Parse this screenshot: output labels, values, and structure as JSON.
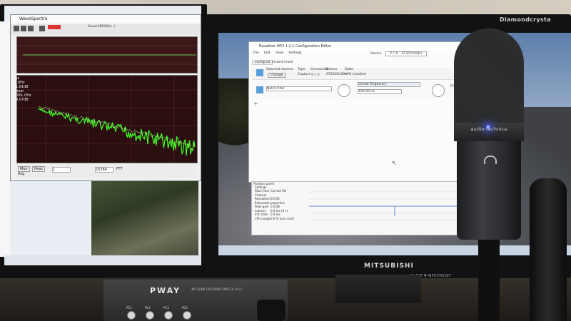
{
  "left_monitor": {
    "wavespectra": {
      "title": "WaveSpectra",
      "toolbar_device": "Sound AB1000s(...)",
      "readout_lines": [
        "Max",
        "21.0Hz",
        "-81.81dB",
        "Cursor",
        "1000L.0Hz",
        "-99.07dB"
      ],
      "top_plot_ticks": [
        "-100000",
        "-0",
        "-100000"
      ],
      "main_plot_ticks": [
        "-60",
        "-80",
        "-100",
        "-120"
      ],
      "x_ticks": [
        "20",
        "100",
        "1k",
        "10k"
      ],
      "bottom_buttons": [
        "Mon",
        "Peak",
        "Avg"
      ],
      "bottom_fields": [
        "1",
        "16384",
        "FFT"
      ]
    }
  },
  "right_monitor": {
    "brand": "Diamondcrysta",
    "bottom_brand": "MITSUBISHI",
    "bottom_hint": "▲ SELECT ▼ INPUT/RESET",
    "equalizer_apo": {
      "title": "Equalizer APO 1.2.1 Configuration Editor",
      "menu": [
        "File",
        "Edit",
        "View",
        "Settings"
      ],
      "device_label": "Device",
      "device_value": "マイク - AT2020USB+",
      "tab": "config.txt",
      "header": {
        "selected_devices": "Selected devices",
        "change_button": "Change",
        "type_label": "Type",
        "type_value": "Capture",
        "connection_label": "Connection",
        "connection_value": "マイク",
        "device_label": "Device",
        "device_value": "AT2020USB+",
        "state_label": "State",
        "state_value": "APO installed",
        "instant_mode": "Instant mode"
      },
      "filter": {
        "type": "Notch filter",
        "param_label": "Center frequency",
        "param_value": "120.00 Hz",
        "gain_label": "Fil"
      }
    },
    "analysis_panel": {
      "title": "Analysis panel",
      "settings": "Settings",
      "lines": [
        "Start from",
        "Channel",
        "Resolution",
        "Estimated properties",
        "Peak gain",
        "Latency",
        "Init. time",
        "CPU usage"
      ],
      "values": [
        "Current file",
        "",
        "65536",
        "",
        "0.0 dB",
        "0.0 ms (0 s)",
        "0.0 ms",
        "0.0 % (one core)"
      ],
      "y_ticks": [
        "40",
        "20",
        "0",
        "-20",
        "-40",
        "-60",
        "-80"
      ]
    }
  },
  "microphone": {
    "brand": "audio-technica"
  },
  "kvm_switch": {
    "brand": "PWAY",
    "model": "4K HDMI USB KVM SWITCH 4×1",
    "button_labels": [
      "PC1",
      "PC2",
      "PC3",
      "PC4"
    ]
  },
  "colors": {
    "spectrum_trace": "#44ff2a",
    "plot_background": "#2a0e10",
    "eq_curve_accent": "#3a6fd8",
    "mic_led": "#3a4dff"
  }
}
